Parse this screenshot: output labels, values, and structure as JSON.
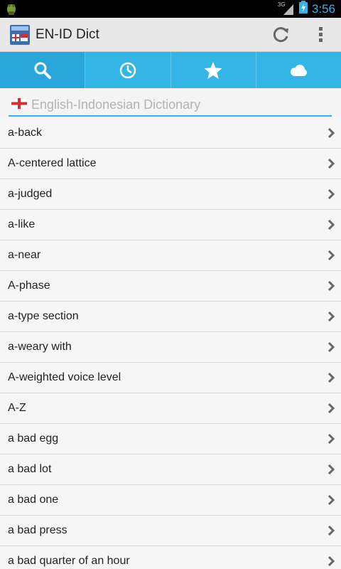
{
  "status_bar": {
    "network": "3G",
    "time": "3:56"
  },
  "action_bar": {
    "title": "EN-ID Dict",
    "icon": "dictionary-app-icon",
    "actions": [
      "refresh-icon",
      "overflow-menu-icon"
    ]
  },
  "tabs": [
    {
      "icon": "search-icon",
      "selected": true
    },
    {
      "icon": "clock-icon",
      "selected": false
    },
    {
      "icon": "star-icon",
      "selected": false
    },
    {
      "icon": "cloud-icon",
      "selected": false
    }
  ],
  "search": {
    "placeholder": "English-Indonesian Dictionary",
    "value": ""
  },
  "words": [
    {
      "label": "a-back"
    },
    {
      "label": "A-centered lattice"
    },
    {
      "label": "a-judged"
    },
    {
      "label": "a-like"
    },
    {
      "label": "a-near"
    },
    {
      "label": "A-phase"
    },
    {
      "label": "a-type section"
    },
    {
      "label": "a-weary with"
    },
    {
      "label": "A-weighted voice level"
    },
    {
      "label": "A-Z"
    },
    {
      "label": "a bad egg"
    },
    {
      "label": "a bad lot"
    },
    {
      "label": "a bad one"
    },
    {
      "label": "a bad press"
    },
    {
      "label": "a bad quarter of an hour"
    }
  ],
  "colors": {
    "accent": "#33b5e5",
    "status_bar": "#000000",
    "action_bar": "#e8e8e8",
    "list_bg": "#f6f6f6"
  }
}
